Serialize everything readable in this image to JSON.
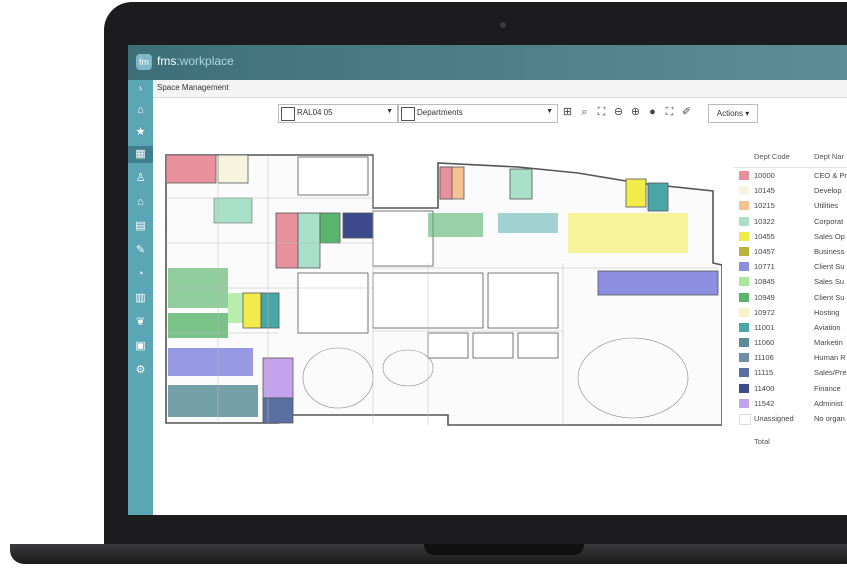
{
  "app": {
    "brand_prefix": "fms",
    "brand_suffix": ":workplace"
  },
  "breadcrumb": "Space Management",
  "toolbar": {
    "floor": "RAL04 05",
    "layer": "Departments",
    "actions_label": "Actions"
  },
  "sidebar": {
    "icons": [
      "home-icon",
      "star-icon",
      "floorplan-icon",
      "workstation-icon",
      "building-icon",
      "chart-icon",
      "wrench-icon",
      "pie-chart-icon",
      "report-icon",
      "leaf-icon",
      "calculator-icon",
      "settings-icon"
    ]
  },
  "legend": {
    "col_code": "Dept Code",
    "col_name": "Dept Nar",
    "total_label": "Total",
    "rows": [
      {
        "code": "10000",
        "name": "CEO & Pr",
        "color": "#e8919c"
      },
      {
        "code": "10145",
        "name": "Develop",
        "color": "#f6f4dc"
      },
      {
        "code": "10215",
        "name": "Utilities",
        "color": "#f5c393"
      },
      {
        "code": "10322",
        "name": "Corporat",
        "color": "#a8e0c8"
      },
      {
        "code": "10455",
        "name": "Sales Op",
        "color": "#f2ec4a"
      },
      {
        "code": "10457",
        "name": "Business",
        "color": "#b9b33a"
      },
      {
        "code": "10771",
        "name": "Client Su",
        "color": "#8c8fe0"
      },
      {
        "code": "10845",
        "name": "Sales Su",
        "color": "#a9e89a"
      },
      {
        "code": "10949",
        "name": "Client Su",
        "color": "#59b46c"
      },
      {
        "code": "10972",
        "name": "Hosting",
        "color": "#f7f2c8"
      },
      {
        "code": "11001",
        "name": "Aviation",
        "color": "#4aa7a8"
      },
      {
        "code": "11060",
        "name": "Marketin",
        "color": "#5b8e98"
      },
      {
        "code": "11106",
        "name": "Human R",
        "color": "#6f8ea5"
      },
      {
        "code": "11115",
        "name": "Sales/Pre",
        "color": "#5b6fa3"
      },
      {
        "code": "11400",
        "name": "Finance",
        "color": "#3d4b8c"
      },
      {
        "code": "11542",
        "name": "Administ",
        "color": "#c5a2ee"
      },
      {
        "code": "Unassigned",
        "name": "No organ",
        "color": "#ffffff"
      }
    ]
  }
}
